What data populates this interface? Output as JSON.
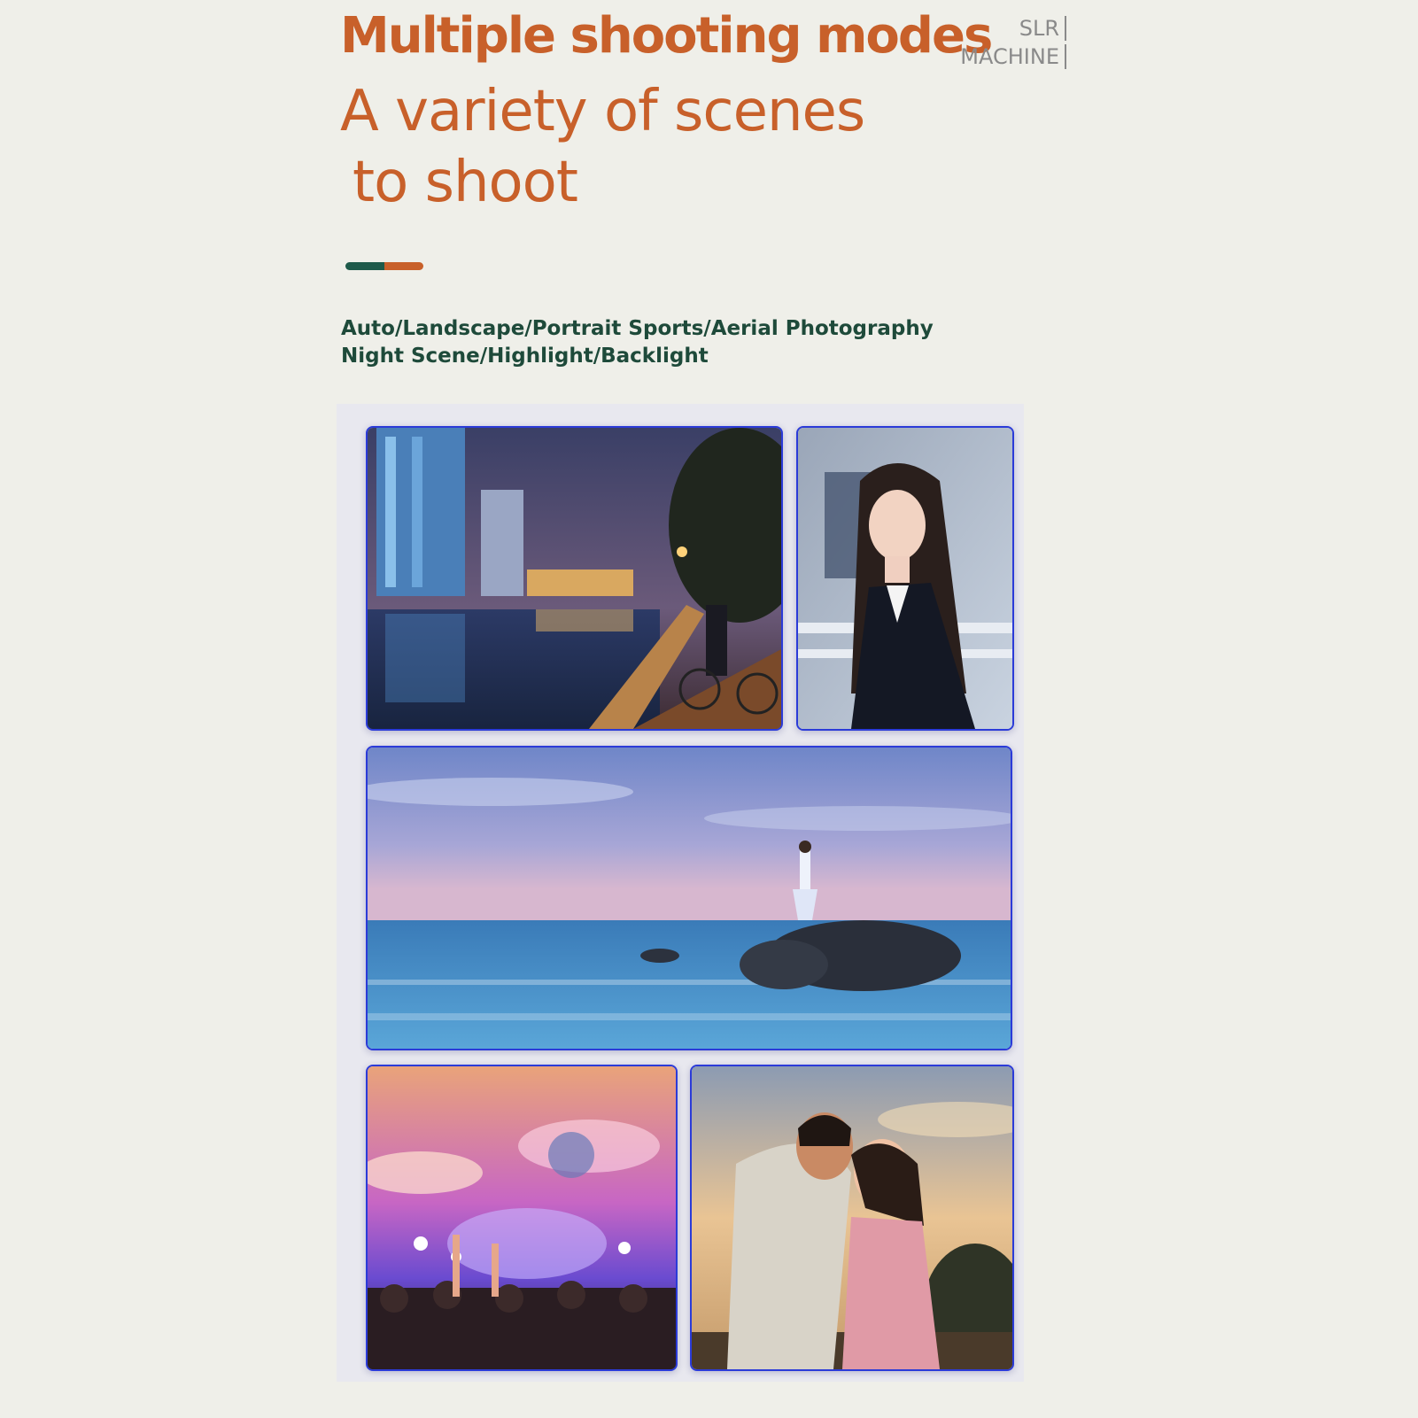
{
  "header": {
    "headline": "Multiple shooting modes",
    "side_tag_line1": "SLR",
    "side_tag_line2": "MACHINE",
    "subline_line1": "A variety of scenes",
    "subline_line2": "to shoot"
  },
  "modes": {
    "line1": "Auto/Landscape/Portrait Sports/Aerial Photography",
    "line2": "Night Scene/Highlight/Backlight"
  },
  "colors": {
    "accent_orange": "#c8602a",
    "accent_green": "#1e5a4a",
    "mode_text": "#1e4a3a",
    "photo_border": "#2b3bd8",
    "background": "#efefe9"
  }
}
